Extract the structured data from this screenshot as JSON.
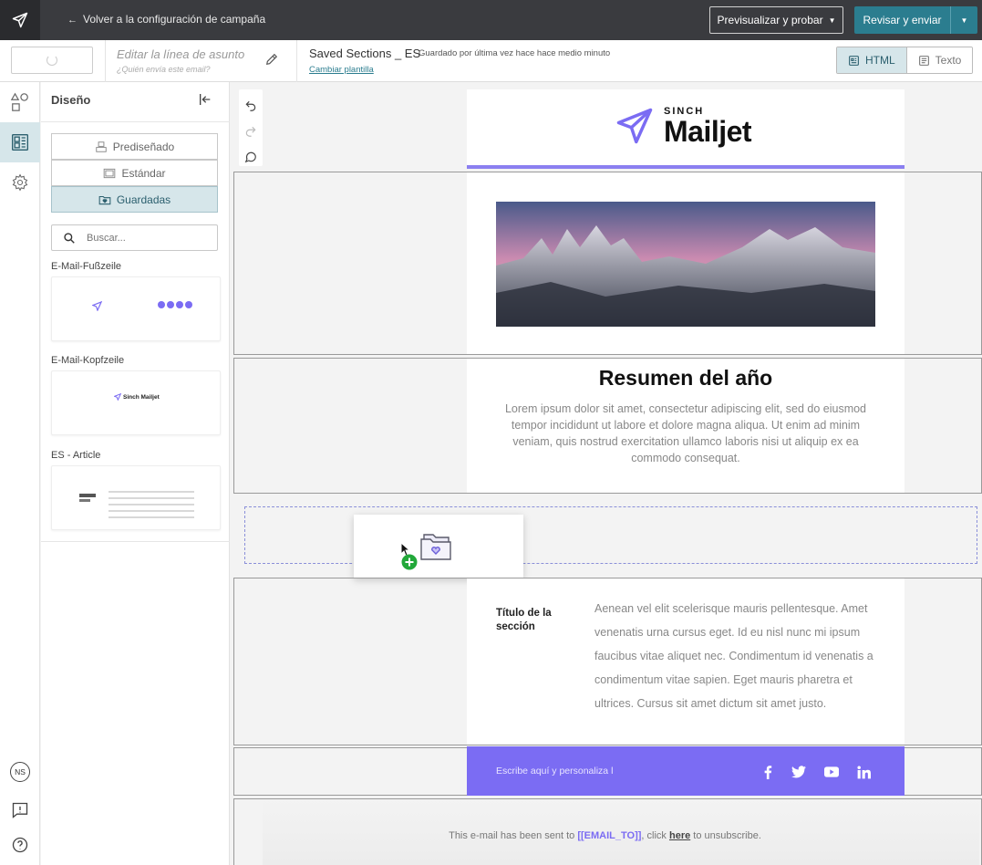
{
  "topbar": {
    "back_label": "Volver a la configuración de campaña",
    "preview_label": "Previsualizar y probar",
    "send_label": "Revisar y enviar"
  },
  "subbar": {
    "subject_placeholder": "Editar la línea de asunto",
    "from_placeholder": "¿Quién envía este email?",
    "title": "Saved Sections _ ES",
    "saved_note": "Guardado por última vez hace hace medio minuto",
    "change_template": "Cambiar plantilla",
    "view_html": "HTML",
    "view_text": "Texto"
  },
  "rail": {
    "avatar_initials": "NS"
  },
  "panel": {
    "title": "Diseño",
    "segments": [
      "Prediseñado",
      "Estándar",
      "Guardadas"
    ],
    "active_segment": "Guardadas",
    "search_placeholder": "Buscar...",
    "sections": [
      {
        "label": "E-Mail-Fußzeile"
      },
      {
        "label": "E-Mail-Kopfzeile",
        "preview_text": "Sinch Mailjet"
      },
      {
        "label": "ES - Article"
      }
    ]
  },
  "email": {
    "brand_top": "SINCH",
    "brand_name": "Mailjet",
    "accent_color": "#7b6cf3",
    "headline": "Resumen del año",
    "lorem": "Lorem ipsum dolor sit amet, consectetur adipiscing elit, sed do eiusmod tempor incididunt ut labore et dolore magna aliqua. Ut enim ad minim veniam, quis nostrud exercitation ullamco laboris nisi ut aliquip ex ea commodo consequat.",
    "article_title": "Título de la sección",
    "article_body": "Aenean vel elit scelerisque mauris pellentesque. Amet venenatis urna cursus eget. Id eu nisl nunc mi ipsum faucibus vitae aliquet nec. Condimentum id venenatis a condimentum vitae sapien. Eget mauris pharetra et ultrices. Cursus sit amet dictum sit amet justo.",
    "footer_text": "Escribe aquí y personaliza l",
    "social_icons": [
      "facebook-icon",
      "twitter-icon",
      "youtube-icon",
      "linkedin-icon"
    ],
    "unsub_prefix": "This e-mail has been sent to ",
    "unsub_tag": "[[EMAIL_TO]]",
    "unsub_mid": ", click ",
    "unsub_link": "here",
    "unsub_suffix": " to unsubscribe."
  }
}
